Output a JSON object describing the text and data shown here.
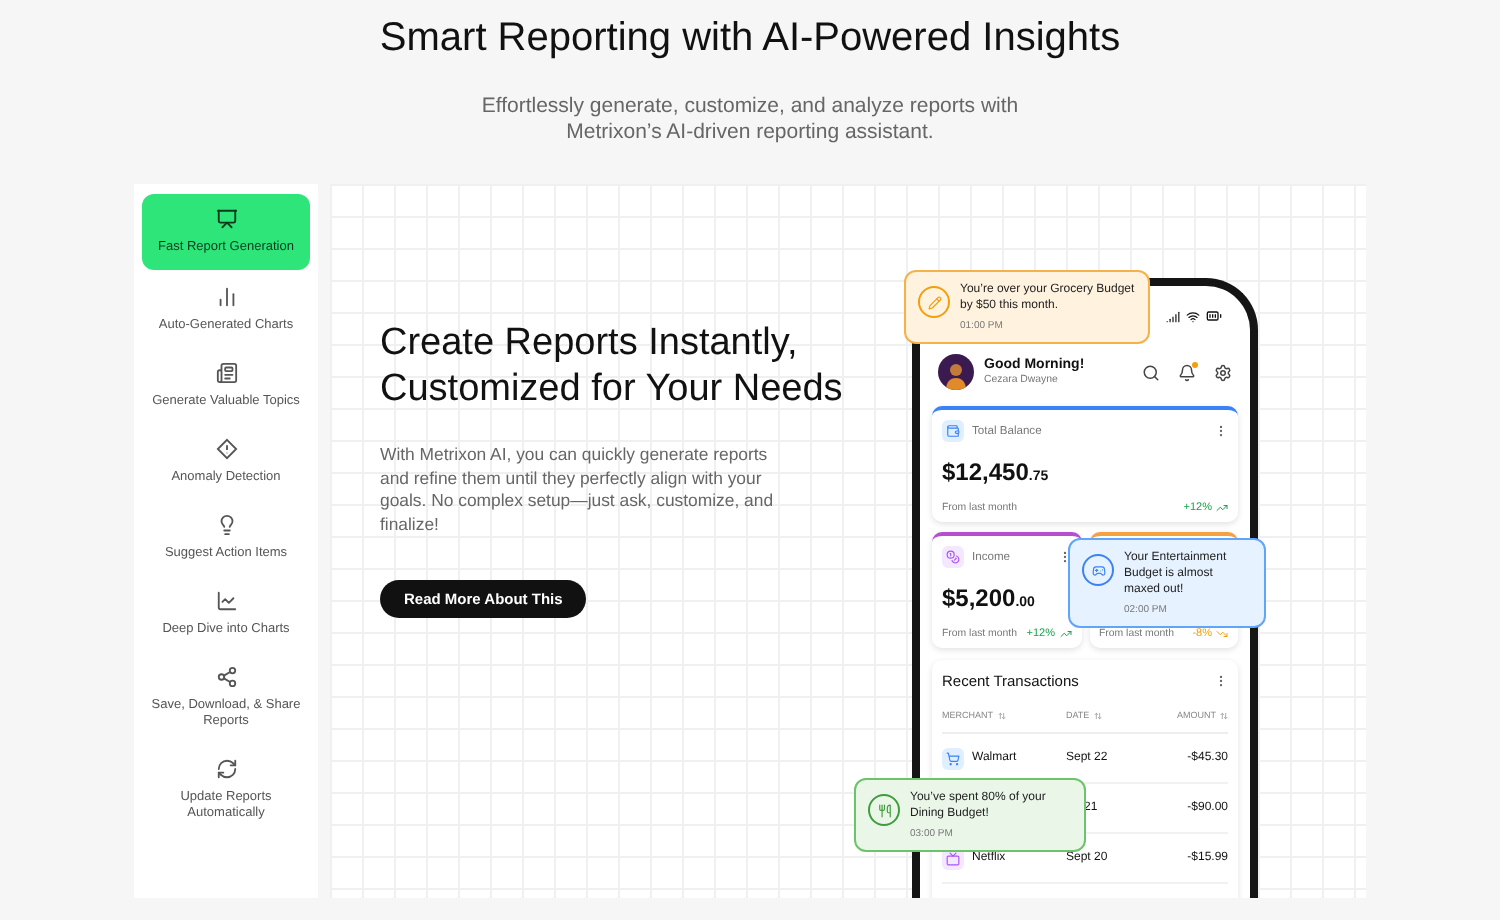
{
  "header": {
    "title": "Smart Reporting with AI-Powered Insights",
    "subtitle": "Effortlessly generate, customize, and analyze reports with Metrixon’s AI-driven reporting assistant."
  },
  "features": [
    {
      "label": "Fast Report Generation",
      "selected": true
    },
    {
      "label": "Auto-Generated Charts",
      "selected": false
    },
    {
      "label": "Generate Valuable Topics",
      "selected": false
    },
    {
      "label": "Anomaly Detection",
      "selected": false
    },
    {
      "label": "Suggest Action Items",
      "selected": false
    },
    {
      "label": "Deep Dive into Charts",
      "selected": false
    },
    {
      "label": "Save, Download, & Share Reports",
      "selected": false
    },
    {
      "label": "Update Reports Automatically",
      "selected": false
    }
  ],
  "hero": {
    "title": "Create Reports Instantly, Customized for Your Needs",
    "body": "With Metrixon AI, you can quickly generate reports and refine them until they perfectly align with your goals. No complex setup—just ask, customize, and finalize!",
    "button": "Read More About This"
  },
  "phone": {
    "greeting": "Good Morning!",
    "user": "Cezara Dwayne",
    "unread": true,
    "balance": {
      "label": "Total Balance",
      "amount": "$12,450",
      "cents": ".75",
      "caption": "From last month",
      "change": "+12%"
    },
    "income": {
      "label": "Income",
      "amount": "$5,200",
      "cents": ".00",
      "caption": "From last month",
      "change": "+12%"
    },
    "spending": {
      "caption": "From last month",
      "change": "-8%"
    },
    "transactions": {
      "title": "Recent Transactions",
      "columns": [
        "MERCHANT",
        "DATE",
        "AMOUNT"
      ],
      "rows": [
        {
          "merchant": "Walmart",
          "date": "Sept 22",
          "amount": "-$45.30"
        },
        {
          "date": "21",
          "amount": "-$90.00"
        },
        {
          "merchant": "Netflix",
          "date": "Sept 20",
          "amount": "-$15.99"
        }
      ]
    }
  },
  "toasts": [
    {
      "kind": "warning",
      "text": "You’re over your Grocery Budget by $50 this month.",
      "time": "01:00 PM"
    },
    {
      "kind": "info",
      "text": "Your Entertainment Budget is almost maxed out!",
      "time": "02:00 PM"
    },
    {
      "kind": "success",
      "text": "You’ve spent 80% of your Dining Budget!",
      "time": "03:00 PM"
    }
  ]
}
